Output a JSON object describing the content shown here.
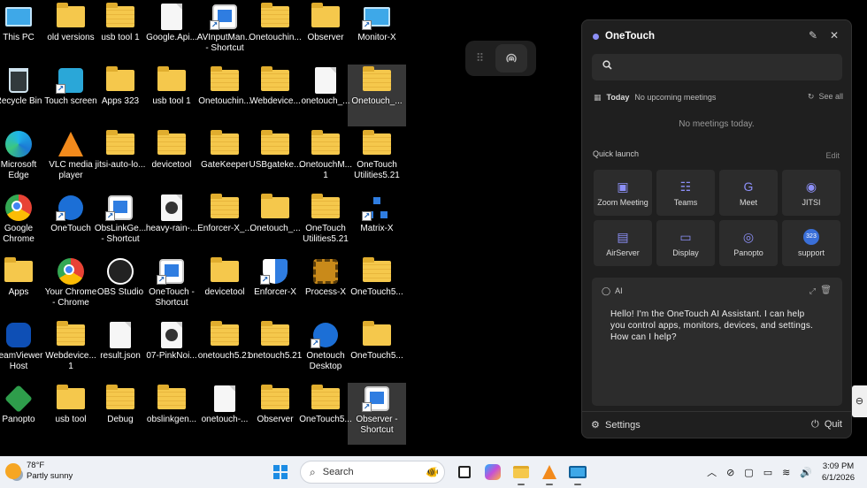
{
  "desktop": {
    "icons": [
      {
        "label": "This PC",
        "glyph": "monitor",
        "col": 0,
        "row": 0
      },
      {
        "label": "old versions",
        "glyph": "folder",
        "col": 1,
        "row": 0
      },
      {
        "label": "usb tool 1",
        "glyph": "zip",
        "col": 2,
        "row": 0
      },
      {
        "label": "Google.Api...",
        "glyph": "file",
        "col": 3,
        "row": 0
      },
      {
        "label": "AVInputMan...\n- Shortcut",
        "glyph": "app-blue",
        "col": 4,
        "row": 0,
        "shortcut": true
      },
      {
        "label": "Onetouchin...",
        "glyph": "zip",
        "col": 5,
        "row": 0
      },
      {
        "label": "Observer",
        "glyph": "folder",
        "col": 6,
        "row": 0
      },
      {
        "label": "Monitor-X",
        "glyph": "monitor",
        "col": 7,
        "row": 0,
        "shortcut": true
      },
      {
        "label": "Recycle Bin",
        "glyph": "bin",
        "col": 0,
        "row": 1
      },
      {
        "label": "Touch screen",
        "glyph": "app-cyan",
        "col": 1,
        "row": 1,
        "shortcut": true
      },
      {
        "label": "Apps 323",
        "glyph": "folder",
        "col": 2,
        "row": 1
      },
      {
        "label": "usb tool 1",
        "glyph": "folder",
        "col": 3,
        "row": 1
      },
      {
        "label": "Onetouchin...",
        "glyph": "zip",
        "col": 4,
        "row": 1
      },
      {
        "label": "Webdevice...",
        "glyph": "zip",
        "col": 5,
        "row": 1
      },
      {
        "label": "onetouch_...",
        "glyph": "file",
        "col": 6,
        "row": 1
      },
      {
        "label": "Onetouch_...",
        "glyph": "zip",
        "col": 7,
        "row": 1,
        "selected": true
      },
      {
        "label": "Microsoft\nEdge",
        "glyph": "edge",
        "col": 0,
        "row": 2
      },
      {
        "label": "VLC media\nplayer",
        "glyph": "vlc",
        "col": 1,
        "row": 2
      },
      {
        "label": "jitsi-auto-lo...",
        "glyph": "zip",
        "col": 2,
        "row": 2
      },
      {
        "label": "devicetool",
        "glyph": "zip",
        "col": 3,
        "row": 2
      },
      {
        "label": "GateKeeper",
        "glyph": "zip",
        "col": 4,
        "row": 2
      },
      {
        "label": "USBgateke...",
        "glyph": "zip",
        "col": 5,
        "row": 2
      },
      {
        "label": "OnetouchM...\n1",
        "glyph": "zip",
        "col": 6,
        "row": 2
      },
      {
        "label": "OneTouch\nUtilities5.21",
        "glyph": "zip",
        "col": 7,
        "row": 2
      },
      {
        "label": "Google\nChrome",
        "glyph": "chrome",
        "col": 0,
        "row": 3
      },
      {
        "label": "OneTouch",
        "glyph": "onetouch",
        "col": 1,
        "row": 3,
        "shortcut": true
      },
      {
        "label": "ObsLinkGe...\n- Shortcut",
        "glyph": "app-blue",
        "col": 2,
        "row": 3,
        "shortcut": true
      },
      {
        "label": "heavy-rain-...",
        "glyph": "media",
        "col": 3,
        "row": 3
      },
      {
        "label": "Enforcer-X_...",
        "glyph": "zip",
        "col": 4,
        "row": 3
      },
      {
        "label": "Onetouch_...",
        "glyph": "folder",
        "col": 5,
        "row": 3
      },
      {
        "label": "OneTouch\nUtilities5.21",
        "glyph": "zip",
        "col": 6,
        "row": 3
      },
      {
        "label": "Matrix-X",
        "glyph": "network",
        "col": 7,
        "row": 3,
        "shortcut": true
      },
      {
        "label": "Apps",
        "glyph": "folder",
        "col": 0,
        "row": 4
      },
      {
        "label": "Your Chrome\n- Chrome",
        "glyph": "chrome",
        "col": 1,
        "row": 4
      },
      {
        "label": "OBS Studio",
        "glyph": "obs",
        "col": 2,
        "row": 4
      },
      {
        "label": "OneTouch -\nShortcut",
        "glyph": "app-blue",
        "col": 3,
        "row": 4,
        "shortcut": true
      },
      {
        "label": "devicetool",
        "glyph": "folder",
        "col": 4,
        "row": 4
      },
      {
        "label": "Enforcer-X",
        "glyph": "shield",
        "col": 5,
        "row": 4,
        "shortcut": true
      },
      {
        "label": "Process-X",
        "glyph": "chip",
        "col": 6,
        "row": 4
      },
      {
        "label": "OneTouch5...",
        "glyph": "zip",
        "col": 7,
        "row": 4
      },
      {
        "label": "TeamViewer\nHost",
        "glyph": "teamviewer",
        "col": 0,
        "row": 5
      },
      {
        "label": "Webdevice...\n1",
        "glyph": "zip",
        "col": 1,
        "row": 5
      },
      {
        "label": "result.json",
        "glyph": "file",
        "col": 2,
        "row": 5
      },
      {
        "label": "07-PinkNoi...",
        "glyph": "media",
        "col": 3,
        "row": 5
      },
      {
        "label": "onetouch5.21",
        "glyph": "zip",
        "col": 4,
        "row": 5
      },
      {
        "label": "onetouch5.21",
        "glyph": "zip",
        "col": 5,
        "row": 5
      },
      {
        "label": "Onetouch\nDesktop",
        "glyph": "onetouch",
        "col": 6,
        "row": 5,
        "shortcut": true
      },
      {
        "label": "OneTouch5...",
        "glyph": "folder",
        "col": 7,
        "row": 5
      },
      {
        "label": "Panopto",
        "glyph": "panopto",
        "col": 0,
        "row": 6
      },
      {
        "label": "usb tool",
        "glyph": "folder",
        "col": 1,
        "row": 6
      },
      {
        "label": "Debug",
        "glyph": "zip",
        "col": 2,
        "row": 6
      },
      {
        "label": "obslinkgen...",
        "glyph": "zip",
        "col": 3,
        "row": 6
      },
      {
        "label": "onetouch-...",
        "glyph": "file",
        "col": 4,
        "row": 6
      },
      {
        "label": "Observer",
        "glyph": "zip",
        "col": 5,
        "row": 6
      },
      {
        "label": "OneTouch5...",
        "glyph": "zip",
        "col": 6,
        "row": 6
      },
      {
        "label": "Observer -\nShortcut",
        "glyph": "app-blue",
        "col": 7,
        "row": 6,
        "shortcut": true,
        "selected": true
      }
    ]
  },
  "pill": {
    "dots_icon": "grid-dots-icon",
    "cast_icon": "broadcast-icon"
  },
  "panel": {
    "title": "OneTouch",
    "accent": "#8c8ff7",
    "search_placeholder": "",
    "today_label": "Today",
    "upcoming_text": "No upcoming meetings",
    "see_all": "See all",
    "no_meetings": "No meetings today.",
    "quick_launch": "Quick launch",
    "edit": "Edit",
    "tiles": [
      {
        "label": "Zoom Meeting",
        "icon": "▣"
      },
      {
        "label": "Teams",
        "icon": "☷"
      },
      {
        "label": "Meet",
        "icon": "G"
      },
      {
        "label": "JITSI",
        "icon": "◉"
      },
      {
        "label": "AirServer",
        "icon": "▤"
      },
      {
        "label": "Display",
        "icon": "▭"
      },
      {
        "label": "Panopto",
        "icon": "◎"
      },
      {
        "label": "support",
        "icon": "323",
        "badge": true
      }
    ],
    "ai_label": "AI",
    "ai_message": "Hello! I'm the OneTouch AI Assistant. I can help you control apps, monitors, devices, and settings. How can I help?",
    "settings": "Settings",
    "quit": "Quit"
  },
  "taskbar": {
    "weather_temp": "78°F",
    "weather_desc": "Partly sunny",
    "search_label": "Search",
    "clock_time": "3:09 PM",
    "clock_date": "6/1/2026"
  }
}
